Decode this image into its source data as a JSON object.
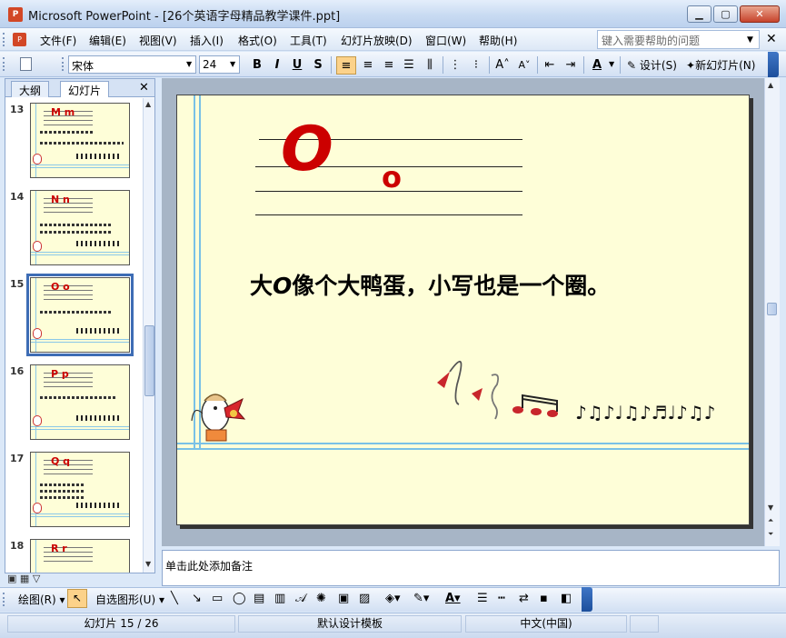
{
  "window": {
    "title": "Microsoft PowerPoint - [26个英语字母精品教学课件.ppt]",
    "app_icon": "P"
  },
  "menu": {
    "items": [
      "文件(F)",
      "编辑(E)",
      "视图(V)",
      "插入(I)",
      "格式(O)",
      "工具(T)",
      "幻灯片放映(D)",
      "窗口(W)",
      "帮助(H)"
    ],
    "help_placeholder": "键入需要帮助的问题"
  },
  "toolbar": {
    "font": "宋体",
    "size": "24",
    "bold": "B",
    "italic": "I",
    "underline": "U",
    "shadow": "S",
    "design": "设计(S)",
    "new_slide": "新幻灯片(N)"
  },
  "panel": {
    "tabs": [
      "大纲",
      "幻灯片"
    ],
    "active_tab": "幻灯片",
    "slides": [
      {
        "num": "13",
        "letter": "M m"
      },
      {
        "num": "14",
        "letter": "N n"
      },
      {
        "num": "15",
        "letter": "O o",
        "selected": true
      },
      {
        "num": "16",
        "letter": "P p"
      },
      {
        "num": "17",
        "letter": "Q q"
      },
      {
        "num": "18",
        "letter": "R r"
      }
    ]
  },
  "slide": {
    "upper": "O",
    "lower": "o",
    "sentence_before": "大",
    "sentence_accent": "O",
    "sentence_after": "像个大鸭蛋，小写也是一个圈。"
  },
  "notes": {
    "placeholder": "单击此处添加备注"
  },
  "drawbar": {
    "draw": "绘图(R)",
    "autoshapes": "自选图形(U)"
  },
  "status": {
    "slide_pos": "幻灯片 15 / 26",
    "template": "默认设计模板",
    "language": "中文(中国)"
  },
  "colors": {
    "letter_red": "#cc0000",
    "slide_bg": "#fefed8",
    "accent_blue": "#79c1e6"
  }
}
